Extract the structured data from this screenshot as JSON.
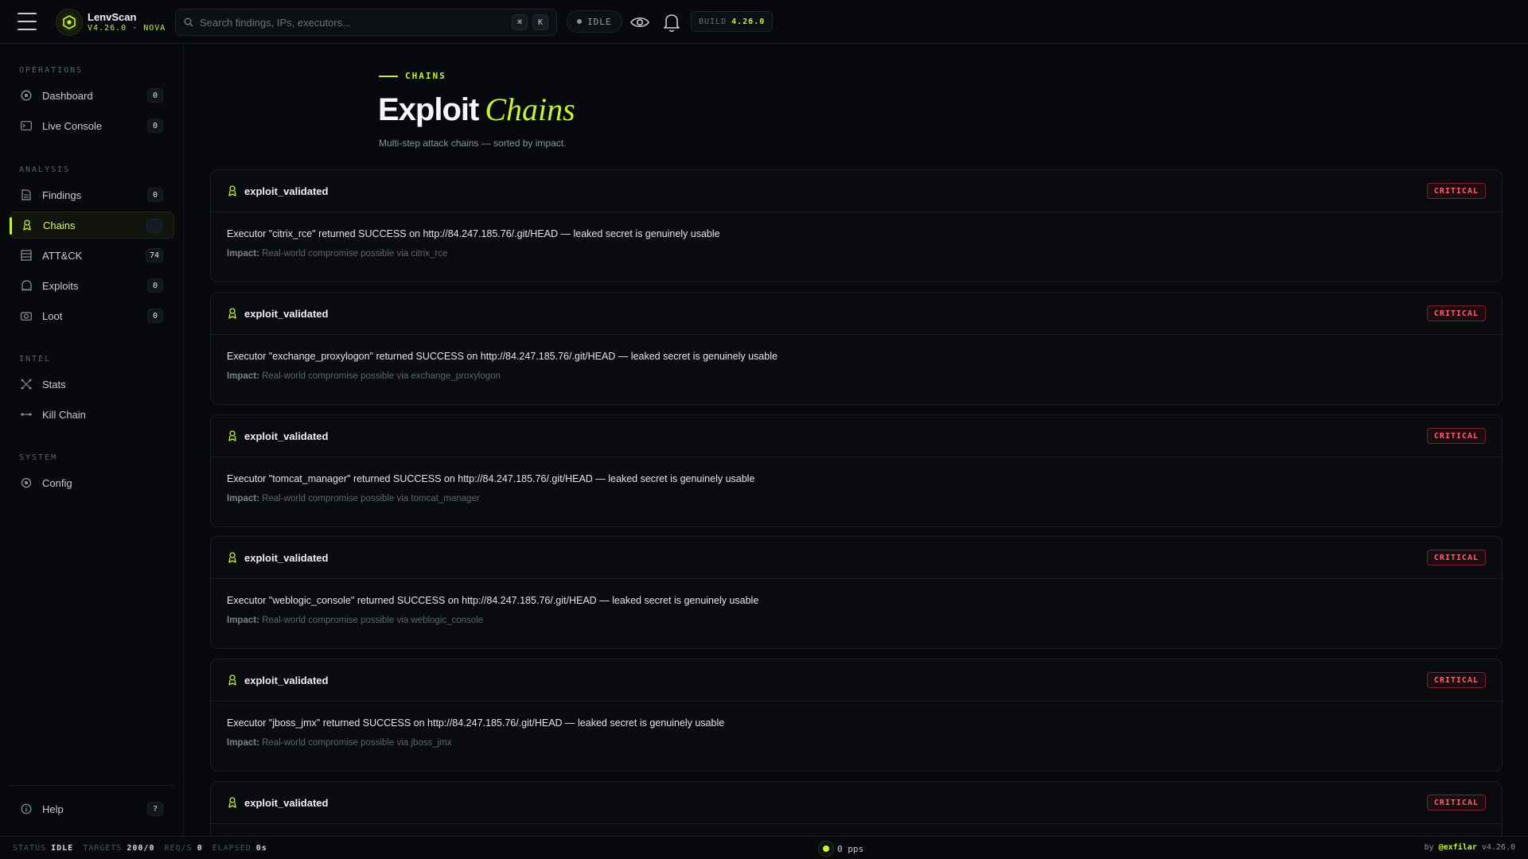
{
  "app": {
    "name": "LenvScan",
    "version_line": "V4.26.0 · NOVA"
  },
  "search": {
    "placeholder": "Search findings, IPs, executors...",
    "shortcut_1": "⌘",
    "shortcut_2": "K"
  },
  "status_pill": "IDLE",
  "build": {
    "label": "BUILD",
    "value": "4.26.0"
  },
  "sidebar": {
    "sections": [
      {
        "label": "OPERATIONS",
        "items": [
          {
            "label": "Dashboard",
            "icon": "dashboard-icon",
            "badge": "0"
          },
          {
            "label": "Live Console",
            "icon": "console-icon",
            "badge": "0"
          }
        ]
      },
      {
        "label": "ANALYSIS",
        "items": [
          {
            "label": "Findings",
            "icon": "document-icon",
            "badge": "0"
          },
          {
            "label": "Chains",
            "icon": "chain-icon",
            "badge": "",
            "active": true
          },
          {
            "label": "ATT&CK",
            "icon": "matrix-icon",
            "badge": "74"
          },
          {
            "label": "Exploits",
            "icon": "ghost-icon",
            "badge": "0"
          },
          {
            "label": "Loot",
            "icon": "camera-icon",
            "badge": "0"
          }
        ]
      },
      {
        "label": "INTEL",
        "items": [
          {
            "label": "Stats",
            "icon": "nodes-icon"
          },
          {
            "label": "Kill Chain",
            "icon": "link-dots-icon"
          }
        ]
      },
      {
        "label": "SYSTEM",
        "items": [
          {
            "label": "Config",
            "icon": "gear-icon"
          }
        ]
      }
    ],
    "help": {
      "label": "Help",
      "badge": "?"
    }
  },
  "page": {
    "eyebrow": "CHAINS",
    "title": "Exploit",
    "title_accent": "Chains",
    "subtitle": "Multi-step attack chains — sorted by impact."
  },
  "chains": [
    {
      "title": "exploit_validated",
      "severity": "CRITICAL",
      "description": "Executor \"citrix_rce\" returned SUCCESS on http://84.247.185.76/.git/HEAD — leaked secret is genuinely usable",
      "impact_label": "Impact:",
      "impact": "Real-world compromise possible via citrix_rce"
    },
    {
      "title": "exploit_validated",
      "severity": "CRITICAL",
      "description": "Executor \"exchange_proxylogon\" returned SUCCESS on http://84.247.185.76/.git/HEAD — leaked secret is genuinely usable",
      "impact_label": "Impact:",
      "impact": "Real-world compromise possible via exchange_proxylogon"
    },
    {
      "title": "exploit_validated",
      "severity": "CRITICAL",
      "description": "Executor \"tomcat_manager\" returned SUCCESS on http://84.247.185.76/.git/HEAD — leaked secret is genuinely usable",
      "impact_label": "Impact:",
      "impact": "Real-world compromise possible via tomcat_manager"
    },
    {
      "title": "exploit_validated",
      "severity": "CRITICAL",
      "description": "Executor \"weblogic_console\" returned SUCCESS on http://84.247.185.76/.git/HEAD — leaked secret is genuinely usable",
      "impact_label": "Impact:",
      "impact": "Real-world compromise possible via weblogic_console"
    },
    {
      "title": "exploit_validated",
      "severity": "CRITICAL",
      "description": "Executor \"jboss_jmx\" returned SUCCESS on http://84.247.185.76/.git/HEAD — leaked secret is genuinely usable",
      "impact_label": "Impact:",
      "impact": "Real-world compromise possible via jboss_jmx"
    },
    {
      "title": "exploit_validated",
      "severity": "CRITICAL"
    }
  ],
  "statusbar": {
    "status_label": "STATUS",
    "status_value": "IDLE",
    "targets_label": "TARGETS",
    "targets_value": "200/0",
    "reqs_label": "REQ/S",
    "reqs_value": "0",
    "elapsed_label": "ELAPSED",
    "elapsed_value": "0s",
    "pps": "0 pps",
    "by_label": "by",
    "handle": "@exfilar",
    "version": "v4.26.0"
  },
  "colors": {
    "accent": "#c6f23a",
    "critical": "#ff5f73",
    "background": "#07090d"
  }
}
